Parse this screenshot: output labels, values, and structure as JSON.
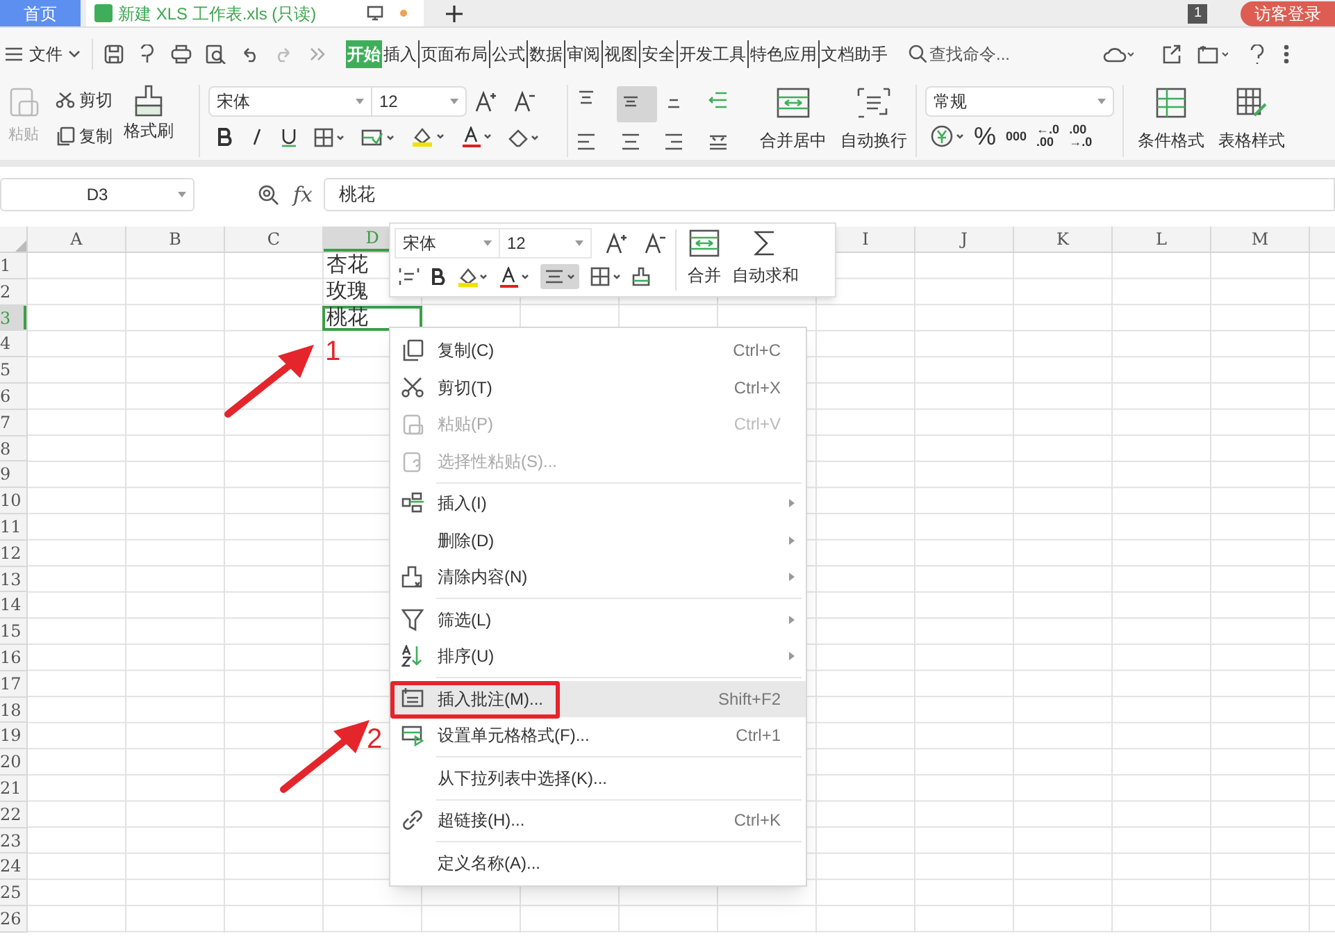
{
  "title_bar": {
    "home_tab": "首页",
    "doc_tab": "新建 XLS 工作表.xls (只读)",
    "window_count": "1",
    "login_button": "访客登录"
  },
  "menu_bar": {
    "file_menu": "文件",
    "tabs": [
      {
        "label": "开始",
        "selected": true
      },
      {
        "label": "插入",
        "selected": false
      },
      {
        "label": "页面布局",
        "selected": false
      },
      {
        "label": "公式",
        "selected": false
      },
      {
        "label": "数据",
        "selected": false
      },
      {
        "label": "审阅",
        "selected": false
      },
      {
        "label": "视图",
        "selected": false
      },
      {
        "label": "安全",
        "selected": false
      },
      {
        "label": "开发工具",
        "selected": false
      },
      {
        "label": "特色应用",
        "selected": false
      },
      {
        "label": "文档助手",
        "selected": false
      }
    ],
    "search": {
      "placeholder": "查找命令..."
    }
  },
  "ribbon": {
    "paste": {
      "label": "粘贴",
      "disabled": true
    },
    "cut": "剪切",
    "copy": "复制",
    "format_painter": "格式刷",
    "font_name": "宋体",
    "font_size": "12",
    "merge_center": "合并居中",
    "wrap_text": "自动换行",
    "number_format": "常规",
    "percent": "%",
    "thousands": "000",
    "add_decimal": {
      "top": "←.0",
      "bottom": ".00"
    },
    "remove_decimal": {
      "top": ".00",
      "bottom": "→.0"
    },
    "conditional_format": "条件格式",
    "table_style": "表格样式"
  },
  "formula_bar": {
    "name_box": "D3",
    "fx": "fx",
    "value": "桃花"
  },
  "sheet": {
    "columns_left": [
      {
        "label": "A",
        "selected": false
      },
      {
        "label": "B",
        "selected": false
      },
      {
        "label": "C",
        "selected": false
      },
      {
        "label": "D",
        "selected": true
      }
    ],
    "columns_right": [
      {
        "label": "I",
        "selected": false
      },
      {
        "label": "J",
        "selected": false
      },
      {
        "label": "K",
        "selected": false
      },
      {
        "label": "L",
        "selected": false
      },
      {
        "label": "M",
        "selected": false
      }
    ],
    "rows": [
      {
        "header": "1",
        "selected": false,
        "D": "杏花"
      },
      {
        "header": "2",
        "selected": false,
        "D": "玫瑰"
      },
      {
        "header": "3",
        "selected": true,
        "D": "桃花"
      },
      {
        "header": "4",
        "selected": false
      },
      {
        "header": "5",
        "selected": false
      },
      {
        "header": "6",
        "selected": false
      },
      {
        "header": "7",
        "selected": false
      },
      {
        "header": "8",
        "selected": false
      },
      {
        "header": "9",
        "selected": false
      },
      {
        "header": "10",
        "selected": false
      },
      {
        "header": "11",
        "selected": false
      },
      {
        "header": "12",
        "selected": false
      },
      {
        "header": "13",
        "selected": false
      },
      {
        "header": "14",
        "selected": false
      },
      {
        "header": "15",
        "selected": false
      },
      {
        "header": "16",
        "selected": false
      },
      {
        "header": "17",
        "selected": false
      },
      {
        "header": "18",
        "selected": false
      },
      {
        "header": "19",
        "selected": false
      },
      {
        "header": "20",
        "selected": false
      },
      {
        "header": "21",
        "selected": false
      },
      {
        "header": "22",
        "selected": false
      },
      {
        "header": "23",
        "selected": false
      },
      {
        "header": "24",
        "selected": false
      },
      {
        "header": "25",
        "selected": false
      },
      {
        "header": "26",
        "selected": false
      }
    ]
  },
  "mini_toolbar": {
    "font_name": "宋体",
    "font_size": "12",
    "merge": "合并",
    "autosum": "自动求和"
  },
  "context_menu": {
    "groups": [
      [
        {
          "label": "复制(C)",
          "shortcut": "Ctrl+C",
          "disabled": false,
          "submenu": false,
          "selected": false,
          "marked": false
        },
        {
          "label": "剪切(T)",
          "shortcut": "Ctrl+X",
          "disabled": false,
          "submenu": false,
          "selected": false,
          "marked": false
        },
        {
          "label": "粘贴(P)",
          "shortcut": "Ctrl+V",
          "disabled": true,
          "submenu": false,
          "selected": false,
          "marked": false
        },
        {
          "label": "选择性粘贴(S)...",
          "disabled": true,
          "submenu": false,
          "selected": false,
          "marked": false
        }
      ],
      [
        {
          "label": "插入(I)",
          "disabled": false,
          "submenu": true,
          "selected": false,
          "marked": false
        },
        {
          "label": "删除(D)",
          "disabled": false,
          "submenu": true,
          "selected": false,
          "marked": false
        },
        {
          "label": "清除内容(N)",
          "disabled": false,
          "submenu": true,
          "selected": false,
          "marked": false
        }
      ],
      [
        {
          "label": "筛选(L)",
          "disabled": false,
          "submenu": true,
          "selected": false,
          "marked": false
        },
        {
          "label": "排序(U)",
          "disabled": false,
          "submenu": true,
          "selected": false,
          "marked": false
        }
      ],
      [
        {
          "label": "插入批注(M)...",
          "shortcut": "Shift+F2",
          "disabled": false,
          "submenu": false,
          "selected": true,
          "marked": true
        },
        {
          "label": "设置单元格格式(F)...",
          "shortcut": "Ctrl+1",
          "disabled": false,
          "submenu": false,
          "selected": false,
          "marked": false
        }
      ],
      [
        {
          "label": "从下拉列表中选择(K)...",
          "disabled": false,
          "submenu": false,
          "selected": false,
          "marked": false
        }
      ],
      [
        {
          "label": "超链接(H)...",
          "shortcut": "Ctrl+K",
          "disabled": false,
          "submenu": false,
          "selected": false,
          "marked": false
        }
      ],
      [
        {
          "label": "定义名称(A)...",
          "disabled": false,
          "submenu": false,
          "selected": false,
          "marked": false
        }
      ]
    ]
  },
  "annotations": [
    {
      "label": "1"
    },
    {
      "label": "2"
    }
  ]
}
